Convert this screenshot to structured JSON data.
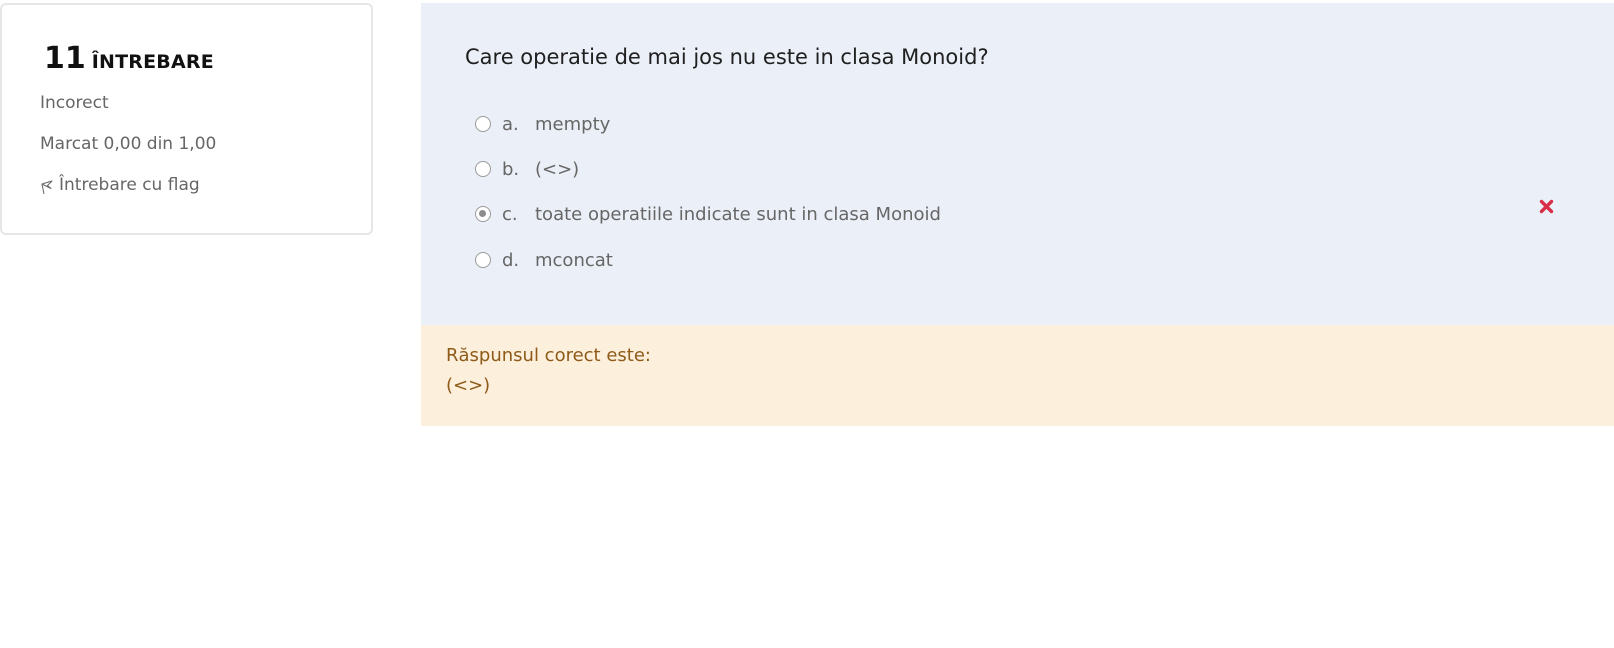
{
  "info": {
    "number": "11",
    "label": "ÎNTREBARE",
    "state": "Incorect",
    "grade": "Marcat 0,00 din 1,00",
    "flag_label": "Întrebare cu flag",
    "flag_icon": "flag-icon"
  },
  "question": {
    "text": "Care operatie de mai jos nu este in clasa Monoid?",
    "answers": [
      {
        "letter": "a.",
        "text": "mempty",
        "selected": false
      },
      {
        "letter": "b.",
        "text": "(<>)",
        "selected": false
      },
      {
        "letter": "c.",
        "text": "toate operatiile indicate sunt in clasa Monoid",
        "selected": true,
        "mark": "incorrect",
        "mark_icon": "red-x-icon"
      },
      {
        "letter": "d.",
        "text": "mconcat",
        "selected": false
      }
    ]
  },
  "feedback": {
    "title": "Răspunsul corect este:",
    "answer": "(<>)"
  },
  "colors": {
    "question_bg": "#ebeff7",
    "feedback_bg": "#fcefdc",
    "feedback_text": "#8e5a18",
    "wrong_mark": "#d9304a"
  }
}
